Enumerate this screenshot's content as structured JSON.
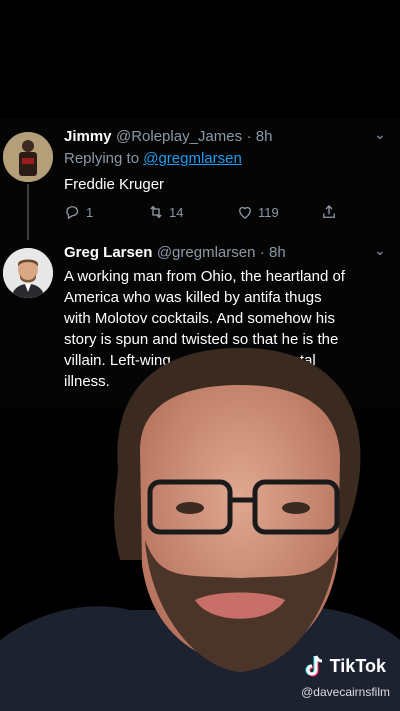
{
  "tweet1": {
    "name": "Jimmy",
    "handle": "@Roleplay_James",
    "time": "· 8h",
    "replying_prefix": "Replying to ",
    "replying_handle": "@gregmlarsen",
    "text": "Freddie Kruger",
    "replies": "1",
    "retweets": "14",
    "likes": "119"
  },
  "tweet2": {
    "name": "Greg Larsen",
    "handle": "@gregmlarsen",
    "time": "· 8h",
    "lines": [
      "A working man from Ohio, the heartland of",
      "America who was killed by antifa thugs",
      "with Molotov cocktails. And somehow his",
      "story is spun and twisted so that he is the",
      "villain. Left-wing                        mental",
      "illness."
    ]
  },
  "watermark": {
    "brand": "TikTok",
    "creator": "@davecairnsfilm"
  },
  "colors": {
    "link": "#1d9bf0",
    "muted": "#8b98a5",
    "text": "#ffffff"
  }
}
